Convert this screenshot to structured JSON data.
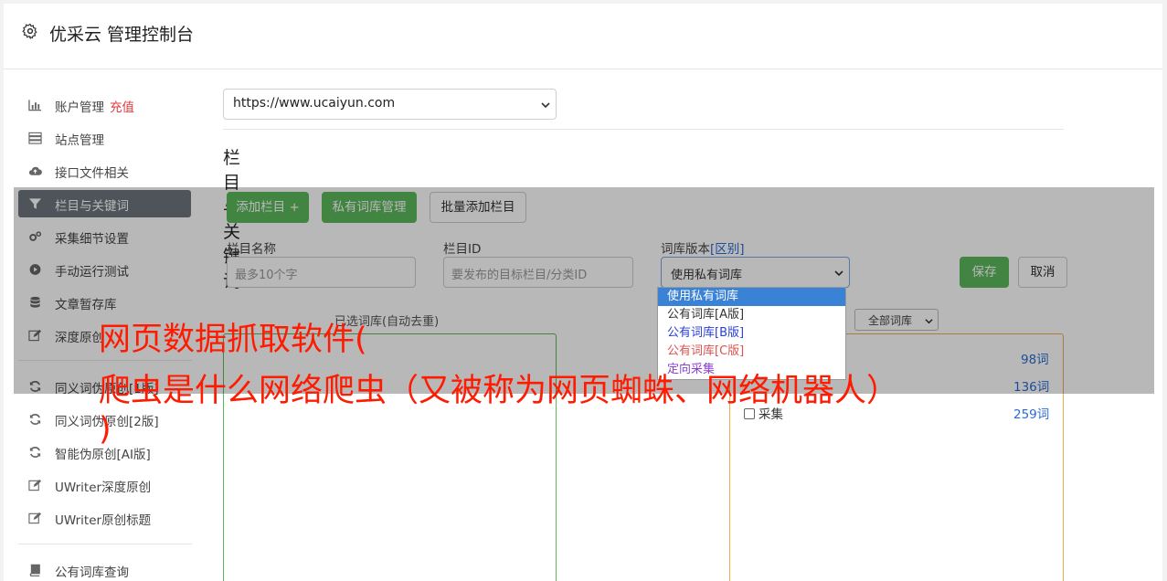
{
  "header": {
    "title": "优采云 管理控制台"
  },
  "sidebar": {
    "items": [
      {
        "label": "账户管理",
        "highlight": "充值",
        "icon": "bar-chart-icon"
      },
      {
        "label": "站点管理",
        "icon": "server-icon"
      },
      {
        "label": "接口文件相关",
        "icon": "cloud-upload-icon"
      },
      {
        "label": "栏目与关键词",
        "icon": "filter-icon",
        "active": true
      },
      {
        "label": "采集细节设置",
        "icon": "gears-icon"
      },
      {
        "label": "手动运行测试",
        "icon": "play-circle-icon"
      },
      {
        "label": "文章暂存库",
        "icon": "database-icon"
      },
      {
        "label": "深度原创",
        "icon": "edit-icon"
      },
      {
        "label": "同义词伪原创[1版]",
        "icon": "refresh-icon"
      },
      {
        "label": "同义词伪原创[2版]",
        "icon": "refresh-icon"
      },
      {
        "label": "智能伪原创[AI版]",
        "icon": "refresh-icon"
      },
      {
        "label": "UWriter深度原创",
        "icon": "edit-icon"
      },
      {
        "label": "UWriter原创标题",
        "icon": "edit-icon"
      },
      {
        "label": "公有词库查询",
        "icon": "book-icon"
      }
    ]
  },
  "main": {
    "site_select": "https://www.ucaiyun.com",
    "section_title": "栏目与关键词",
    "buttons": {
      "add_column": "添加栏目 +",
      "private_lexicon": "私有词库管理",
      "batch_add": "批量添加栏目",
      "save": "保存",
      "cancel": "取消"
    },
    "form": {
      "column_name_label": "栏目名称",
      "column_name_placeholder": "最多10个字",
      "column_id_label": "栏目ID",
      "column_id_placeholder": "要发布的目标栏目/分类ID",
      "lexicon_label": "词库版本",
      "lexicon_link": "[区别]",
      "lexicon_value": "使用私有词库",
      "lexicon_options": [
        "使用私有词库",
        "公有词库[A版]",
        "公有词库[B版]",
        "公有词库[C版]",
        "定向采集"
      ],
      "option_colors": [
        "#ffffff",
        "#333333",
        "#2a3fd6",
        "#d9534f",
        "#8a3fd1"
      ]
    },
    "filter_select": "全部词库",
    "selected_box_caption": "已选词库(自动去重)",
    "counts": [
      "98词",
      "136词",
      "259词"
    ],
    "collect_checkbox": "采集"
  },
  "caption": {
    "line1": "网页数据抓取软件(",
    "line2": "爬虫是什么网络爬虫（又被称为网页蜘蛛、网络机器人）",
    "line3": ")"
  }
}
